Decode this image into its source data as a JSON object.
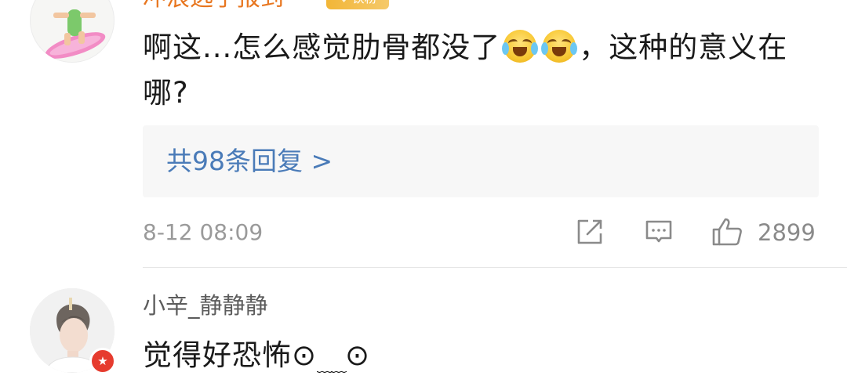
{
  "comments": [
    {
      "username": "冲浪选手报到",
      "fan_badge": "铁粉",
      "text_part1": "啊这...怎么感觉肋骨都没了",
      "emoji_1": "laugh-cry-emoji",
      "emoji_2": "laugh-cry-emoji",
      "text_part2": "，这种的意义在哪?",
      "replies_link": "共98条回复 >",
      "timestamp": "8-12 08:09",
      "like_count": "2899"
    },
    {
      "username": "小辛_静静静",
      "text_part1": "觉得好恐怖",
      "face_left": "⊙",
      "face_mouth": "﹏﹏",
      "face_right": "⊙"
    }
  ],
  "icons": {
    "share": "share-icon",
    "comment": "comment-icon",
    "like": "thumbs-up-icon",
    "verified": "verified-star-icon"
  },
  "colors": {
    "username_vip": "#e8761f",
    "link": "#4a7bb8",
    "meta_gray": "#9a9a9a",
    "badge_gold": "#f2b637",
    "verified_red": "#e63b2e"
  }
}
